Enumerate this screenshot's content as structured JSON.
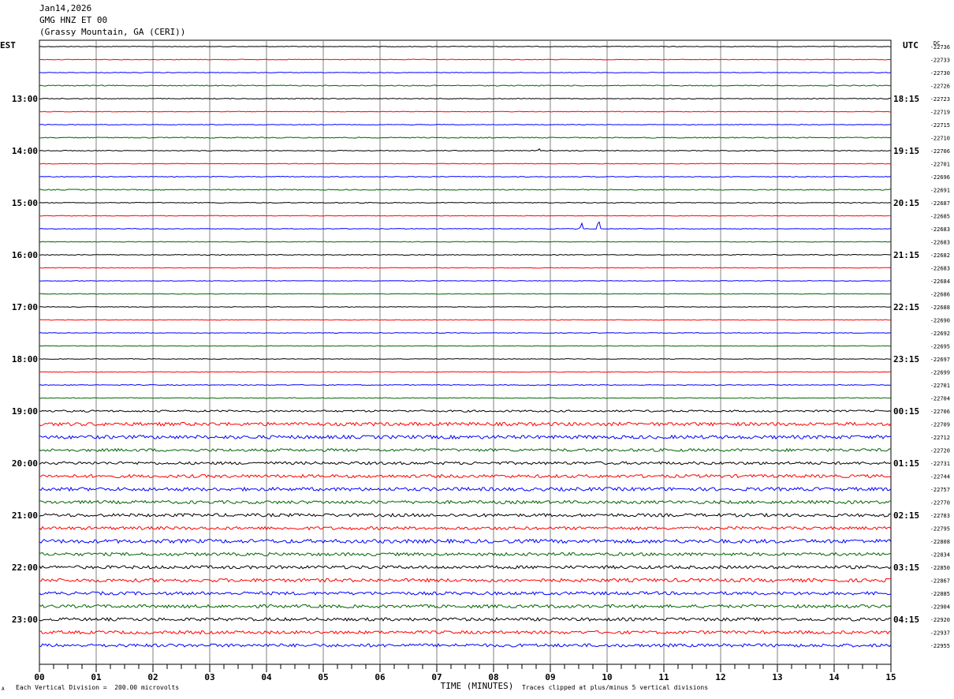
{
  "header": {
    "date": "Jan14,2026",
    "station": "GMG HNZ ET 00",
    "location": "(Grassy Mountain, GA (CERI))"
  },
  "footer": {
    "scale_note": "Each Vertical Division =  200.00 microvolts",
    "clip_note": "Traces clipped at plus/minus 5 vertical divisions",
    "corner_mark": "A"
  },
  "colors": {
    "trace_cycle": [
      "#000000",
      "#ff0000",
      "#0000ff",
      "#006400"
    ],
    "grid": "#808080"
  },
  "chart_data": {
    "type": "line",
    "title": "",
    "xlabel": "TIME (MINUTES)",
    "x_ticks": [
      "00",
      "01",
      "02",
      "03",
      "04",
      "05",
      "06",
      "07",
      "08",
      "09",
      "10",
      "11",
      "12",
      "13",
      "14",
      "15"
    ],
    "xlim": [
      0,
      15
    ],
    "left_axis_label": "EST",
    "right_axis_label": "UTC",
    "dc_label": "DC",
    "left_hour_labels": [
      "13:00",
      "14:00",
      "15:00",
      "16:00",
      "17:00",
      "18:00",
      "19:00",
      "20:00",
      "21:00",
      "22:00",
      "23:00"
    ],
    "right_hour_labels": [
      "18:15",
      "19:15",
      "20:15",
      "21:15",
      "22:15",
      "23:15",
      "00:15",
      "01:15",
      "02:15",
      "03:15",
      "04:15"
    ],
    "dc_offsets": [
      "-22736",
      "-22733",
      "-22730",
      "-22726",
      "-22723",
      "-22719",
      "-22715",
      "-22710",
      "-22706",
      "-22701",
      "-22696",
      "-22691",
      "-22687",
      "-22685",
      "-22683",
      "-22683",
      "-22682",
      "-22683",
      "-22684",
      "-22686",
      "-22688",
      "-22690",
      "-22692",
      "-22695",
      "-22697",
      "-22699",
      "-22701",
      "-22704",
      "-22706",
      "-22709",
      "-22712",
      "-22720",
      "-22731",
      "-22744",
      "-22757",
      "-22770",
      "-22783",
      "-22795",
      "-22808",
      "-22834",
      "-22850",
      "-22867",
      "-22885",
      "-22904",
      "-22920",
      "-22937",
      "-22955"
    ],
    "trace_noise_level": [
      0.4,
      0.4,
      0.4,
      0.6,
      0.5,
      0.4,
      0.4,
      0.6,
      0.5,
      0.4,
      0.5,
      0.6,
      0.5,
      0.4,
      0.4,
      0.4,
      0.5,
      0.4,
      0.4,
      0.4,
      0.4,
      0.4,
      0.4,
      0.4,
      0.4,
      0.4,
      0.5,
      0.5,
      1.2,
      2.2,
      2.2,
      1.8,
      1.8,
      2.0,
      2.2,
      2.0,
      2.0,
      2.0,
      2.4,
      2.0,
      2.0,
      2.2,
      2.0,
      2.0,
      2.0,
      2.0,
      2.0,
      2.0
    ],
    "events": [
      {
        "trace": 14,
        "minute": 9.55,
        "amplitude": 8
      },
      {
        "trace": 14,
        "minute": 9.85,
        "amplitude": 14
      },
      {
        "trace": 8,
        "minute": 8.8,
        "amplitude": 3
      }
    ]
  }
}
